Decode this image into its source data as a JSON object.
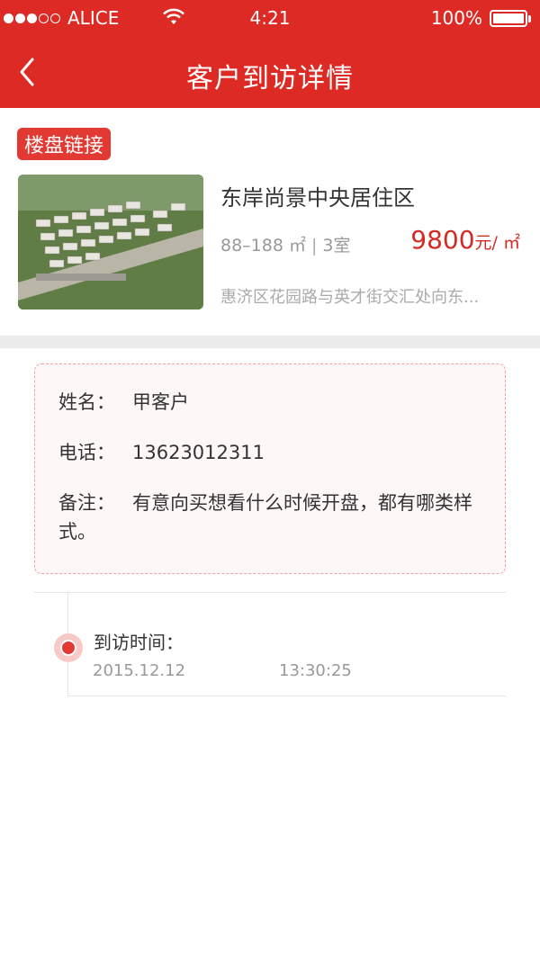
{
  "status_bar": {
    "carrier": "ALICE",
    "time": "4:21",
    "battery": "100%"
  },
  "nav": {
    "title": "客户到访详情"
  },
  "property": {
    "tag": "楼盘链接",
    "name": "东岸尚景中央居住区",
    "area": "88–188 ㎡",
    "rooms": "3室",
    "price": "9800",
    "price_unit": "元/ ㎡",
    "address": "惠济区花园路与英才街交汇处向东..."
  },
  "customer": {
    "name_label": "姓名：",
    "name": "甲客户",
    "phone_label": "电话：",
    "phone": "13623012311",
    "note_label": "备注：",
    "note": "有意向买想看什么时候开盘，都有哪类样式。"
  },
  "visit": {
    "label": "到访时间：",
    "date": "2015.12.12",
    "time": "13:30:25"
  },
  "colors": {
    "accent": "#dd2a24"
  }
}
